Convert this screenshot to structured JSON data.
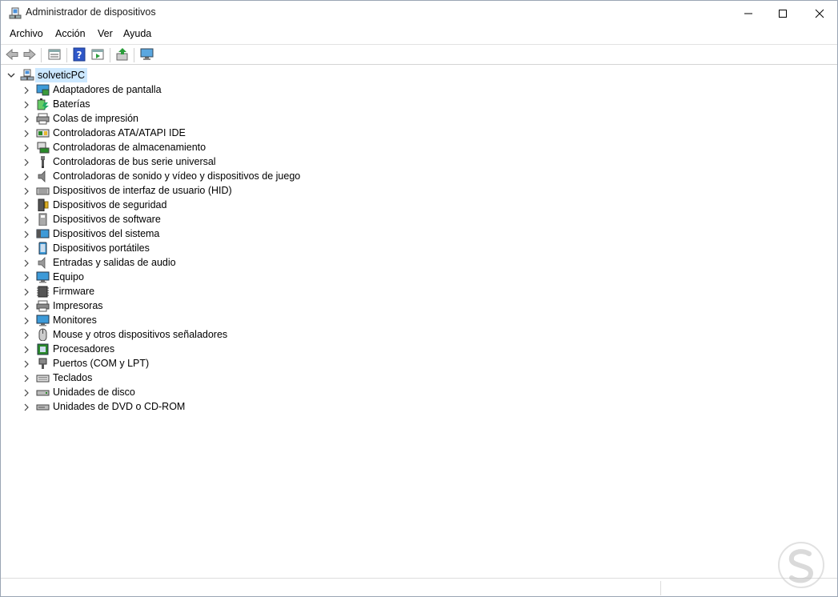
{
  "window": {
    "title": "Administrador de dispositivos",
    "controls": {
      "minimize": "minimize-icon",
      "maximize": "maximize-icon",
      "close": "close-icon"
    }
  },
  "menu": [
    {
      "label": "Archivo"
    },
    {
      "label": "Acción"
    },
    {
      "label": "Ver"
    },
    {
      "label": "Ayuda"
    }
  ],
  "toolbar": {
    "buttons": [
      {
        "icon": "back-arrow-icon"
      },
      {
        "icon": "forward-arrow-icon"
      },
      {
        "icon": "properties-icon"
      },
      {
        "icon": "help-icon"
      },
      {
        "icon": "run-icon"
      },
      {
        "icon": "update-driver-icon"
      },
      {
        "icon": "scan-hardware-icon"
      }
    ]
  },
  "tree": {
    "root": {
      "label": "solveticPC",
      "expanded": true,
      "selected": true,
      "icon": "computer-icon"
    },
    "categories": [
      {
        "label": "Adaptadores de pantalla",
        "icon": "display-adapter-icon"
      },
      {
        "label": "Baterías",
        "icon": "battery-icon"
      },
      {
        "label": "Colas de impresión",
        "icon": "print-queue-icon"
      },
      {
        "label": "Controladoras ATA/ATAPI IDE",
        "icon": "ide-controller-icon"
      },
      {
        "label": "Controladoras de almacenamiento",
        "icon": "storage-controller-icon"
      },
      {
        "label": "Controladoras de bus serie universal",
        "icon": "usb-icon"
      },
      {
        "label": "Controladoras de sonido y vídeo y dispositivos de juego",
        "icon": "speaker-icon"
      },
      {
        "label": "Dispositivos de interfaz de usuario (HID)",
        "icon": "hid-icon"
      },
      {
        "label": "Dispositivos de seguridad",
        "icon": "security-device-icon"
      },
      {
        "label": "Dispositivos de software",
        "icon": "software-device-icon"
      },
      {
        "label": "Dispositivos del sistema",
        "icon": "system-device-icon"
      },
      {
        "label": "Dispositivos portátiles",
        "icon": "portable-device-icon"
      },
      {
        "label": "Entradas y salidas de audio",
        "icon": "audio-io-icon"
      },
      {
        "label": "Equipo",
        "icon": "monitor-icon"
      },
      {
        "label": "Firmware",
        "icon": "firmware-chip-icon"
      },
      {
        "label": "Impresoras",
        "icon": "printer-icon"
      },
      {
        "label": "Monitores",
        "icon": "monitor-icon"
      },
      {
        "label": "Mouse y otros dispositivos señaladores",
        "icon": "mouse-icon"
      },
      {
        "label": "Procesadores",
        "icon": "processor-icon"
      },
      {
        "label": "Puertos (COM y LPT)",
        "icon": "port-icon"
      },
      {
        "label": "Teclados",
        "icon": "keyboard-icon"
      },
      {
        "label": "Unidades de disco",
        "icon": "disk-drive-icon"
      },
      {
        "label": "Unidades de DVD o CD-ROM",
        "icon": "dvd-drive-icon"
      }
    ]
  },
  "colors": {
    "selection": "#cce8ff",
    "accent": "#0078d7"
  }
}
